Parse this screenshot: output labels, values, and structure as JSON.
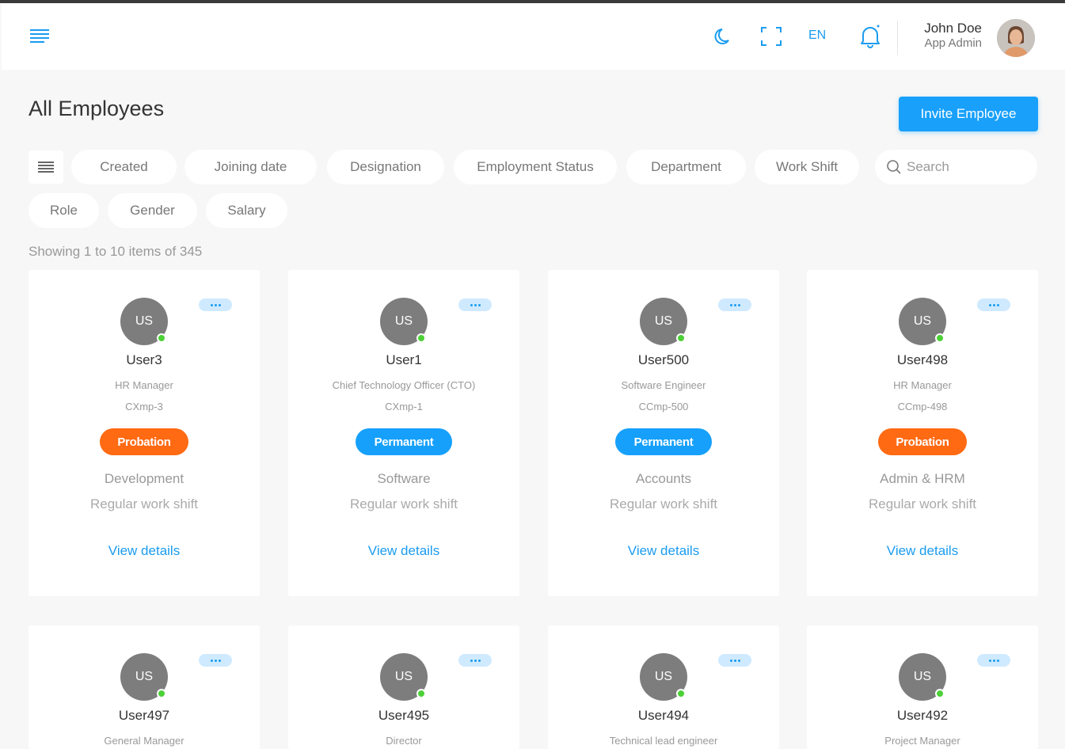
{
  "header": {
    "language": "EN",
    "user": {
      "name": "John Doe",
      "role": "App Admin"
    }
  },
  "page": {
    "title": "All Employees",
    "invite_label": "Invite Employee",
    "showing_text": "Showing 1 to 10 items of 345"
  },
  "filters": {
    "chips": [
      "Created",
      "Joining date",
      "Designation",
      "Employment Status",
      "Department",
      "Work Shift",
      "Role",
      "Gender",
      "Salary"
    ],
    "search_placeholder": "Search"
  },
  "colors": {
    "accent": "#18a0fb",
    "probation": "#ff6a13",
    "permanent": "#16a0fb",
    "online": "#4cd137",
    "avatar_bg": "#7d7d7d"
  },
  "employees": [
    {
      "initials": "US",
      "name": "User3",
      "designation": "HR Manager",
      "emp_id": "CXmp-3",
      "status": "Probation",
      "department": "Development",
      "shift": "Regular work shift",
      "link": "View details"
    },
    {
      "initials": "US",
      "name": "User1",
      "designation": "Chief Technology Officer (CTO)",
      "emp_id": "CXmp-1",
      "status": "Permanent",
      "department": "Software",
      "shift": "Regular work shift",
      "link": "View details"
    },
    {
      "initials": "US",
      "name": "User500",
      "designation": "Software Engineer",
      "emp_id": "CCmp-500",
      "status": "Permanent",
      "department": "Accounts",
      "shift": "Regular work shift",
      "link": "View details"
    },
    {
      "initials": "US",
      "name": "User498",
      "designation": "HR Manager",
      "emp_id": "CCmp-498",
      "status": "Probation",
      "department": "Admin & HRM",
      "shift": "Regular work shift",
      "link": "View details"
    },
    {
      "initials": "US",
      "name": "User497",
      "designation": "General Manager"
    },
    {
      "initials": "US",
      "name": "User495",
      "designation": "Director"
    },
    {
      "initials": "US",
      "name": "User494",
      "designation": "Technical lead engineer"
    },
    {
      "initials": "US",
      "name": "User492",
      "designation": "Project Manager"
    }
  ]
}
